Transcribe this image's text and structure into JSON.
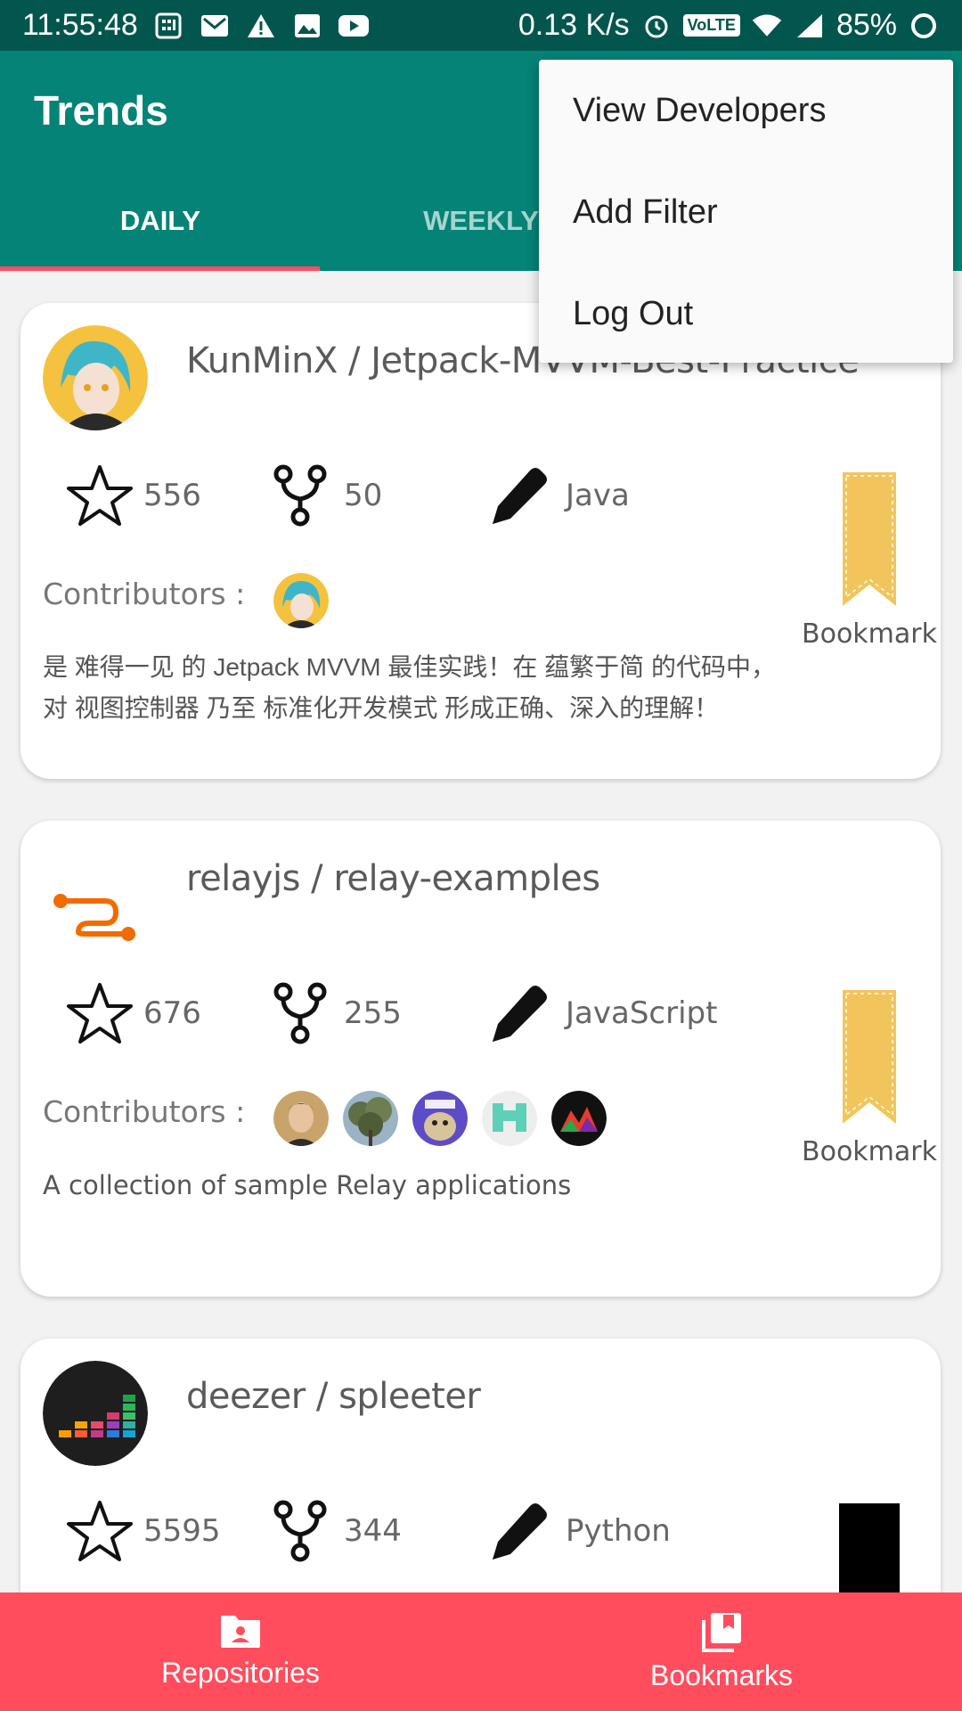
{
  "status_bar": {
    "time": "11:55:48",
    "net_speed": "0.13 K/s",
    "volte": "VoLTE",
    "battery": "85%"
  },
  "app_bar": {
    "title": "Trends"
  },
  "tabs": [
    {
      "label": "DAILY",
      "selected": true
    },
    {
      "label": "WEEKLY",
      "selected": false
    }
  ],
  "overflow_menu": {
    "items": [
      "View Developers",
      "Add Filter",
      "Log Out"
    ]
  },
  "repos": [
    {
      "name": "KunMinX / Jetpack-MVVM-Best-Practice",
      "stars": "556",
      "forks": "50",
      "language": "Java",
      "contributors_label": "Contributors :",
      "description": "是 难得一见 的 Jetpack MVVM 最佳实践！在 蕴繁于简 的代码中，对 视图控制器 乃至 标准化开发模式 形成正确、深入的理解！",
      "bookmark_label": "Bookmark"
    },
    {
      "name": "relayjs / relay-examples",
      "stars": "676",
      "forks": "255",
      "language": "JavaScript",
      "contributors_label": "Contributors :",
      "description": "A collection of sample Relay applications",
      "bookmark_label": "Bookmark"
    },
    {
      "name": "deezer / spleeter",
      "stars": "5595",
      "forks": "344",
      "language": "Python"
    }
  ],
  "bottom_nav": {
    "items": [
      {
        "label": "Repositories",
        "icon": "folder-user-icon"
      },
      {
        "label": "Bookmarks",
        "icon": "bookmarks-icon"
      }
    ]
  },
  "colors": {
    "status_bar": "#03564d",
    "app_bar": "#048376",
    "tab_indicator": "#ff4d66",
    "bottom_nav": "#ff4d5d",
    "bookmark": "#f2c55c"
  }
}
